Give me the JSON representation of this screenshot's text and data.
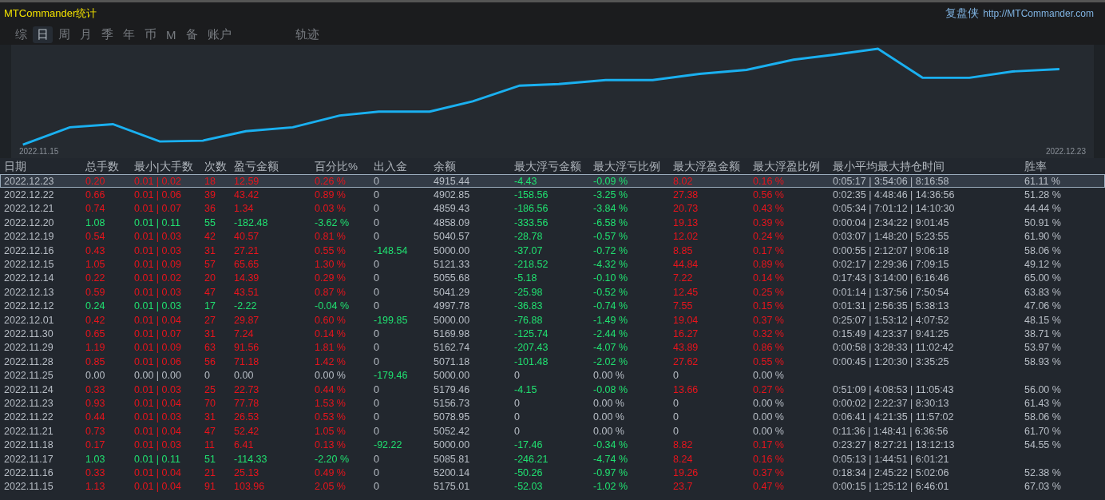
{
  "title": "MTCommander统计",
  "brand": {
    "name": "复盘侠",
    "url": "http://MTCommander.com"
  },
  "tabs": [
    {
      "label": "综",
      "selected": false
    },
    {
      "label": "日",
      "selected": true
    },
    {
      "label": "周",
      "selected": false
    },
    {
      "label": "月",
      "selected": false
    },
    {
      "label": "季",
      "selected": false
    },
    {
      "label": "年",
      "selected": false
    },
    {
      "label": "币",
      "selected": false
    },
    {
      "label": "M",
      "selected": false
    },
    {
      "label": "备",
      "selected": false
    },
    {
      "label": "账户",
      "selected": false
    },
    {
      "label": "轨迹",
      "selected": false
    }
  ],
  "chart": {
    "x_start": "2022.11.15",
    "x_end": "2022.12.23"
  },
  "table": {
    "columns": [
      "日期",
      "总手数",
      "最小|大手数",
      "次数",
      "盈亏金额",
      "百分比%",
      "出入金",
      "余额",
      "最大浮亏金额",
      "最大浮亏比例",
      "最大浮盈金额",
      "最大浮盈比例",
      "最小平均最大持仓时间",
      "胜率"
    ],
    "rows": [
      {
        "selected": true,
        "cells": [
          {
            "text": "2022.12.23",
            "color": "#b8bec6"
          },
          {
            "text": "0.20",
            "color": "#e8141c"
          },
          {
            "text": "0.01 | 0.02",
            "color": "#e8141c"
          },
          {
            "text": "18",
            "color": "#e8141c"
          },
          {
            "text": "12.59",
            "color": "#e8141c"
          },
          {
            "text": "0.26 %",
            "color": "#e8141c"
          },
          {
            "text": "0",
            "color": "#b8bec6"
          },
          {
            "text": "4915.44",
            "color": "#b8bec6"
          },
          {
            "text": "-4.43",
            "color": "#20e070"
          },
          {
            "text": "-0.09 %",
            "color": "#20e070"
          },
          {
            "text": "8.02",
            "color": "#e8141c"
          },
          {
            "text": "0.16 %",
            "color": "#e8141c"
          },
          {
            "text": "0:05:17 | 3:54:06 | 8:16:58",
            "color": "#b8bec6"
          },
          {
            "text": "61.11 %",
            "color": "#b8bec6"
          }
        ]
      },
      {
        "selected": false,
        "cells": [
          {
            "text": "2022.12.22",
            "color": "#b8bec6"
          },
          {
            "text": "0.66",
            "color": "#e8141c"
          },
          {
            "text": "0.01 | 0.06",
            "color": "#e8141c"
          },
          {
            "text": "39",
            "color": "#e8141c"
          },
          {
            "text": "43.42",
            "color": "#e8141c"
          },
          {
            "text": "0.89 %",
            "color": "#e8141c"
          },
          {
            "text": "0",
            "color": "#b8bec6"
          },
          {
            "text": "4902.85",
            "color": "#b8bec6"
          },
          {
            "text": "-158.56",
            "color": "#20e070"
          },
          {
            "text": "-3.25 %",
            "color": "#20e070"
          },
          {
            "text": "27.38",
            "color": "#e8141c"
          },
          {
            "text": "0.56 %",
            "color": "#e8141c"
          },
          {
            "text": "0:02:35 | 4:48:46 | 14:36:56",
            "color": "#b8bec6"
          },
          {
            "text": "51.28 %",
            "color": "#b8bec6"
          }
        ]
      },
      {
        "selected": false,
        "cells": [
          {
            "text": "2022.12.21",
            "color": "#b8bec6"
          },
          {
            "text": "0.74",
            "color": "#e8141c"
          },
          {
            "text": "0.01 | 0.07",
            "color": "#e8141c"
          },
          {
            "text": "36",
            "color": "#e8141c"
          },
          {
            "text": "1.34",
            "color": "#e8141c"
          },
          {
            "text": "0.03 %",
            "color": "#e8141c"
          },
          {
            "text": "0",
            "color": "#b8bec6"
          },
          {
            "text": "4859.43",
            "color": "#b8bec6"
          },
          {
            "text": "-186.56",
            "color": "#20e070"
          },
          {
            "text": "-3.84 %",
            "color": "#20e070"
          },
          {
            "text": "20.73",
            "color": "#e8141c"
          },
          {
            "text": "0.43 %",
            "color": "#e8141c"
          },
          {
            "text": "0:05:34 | 7:01:12 | 14:10:30",
            "color": "#b8bec6"
          },
          {
            "text": "44.44 %",
            "color": "#b8bec6"
          }
        ]
      },
      {
        "selected": false,
        "cells": [
          {
            "text": "2022.12.20",
            "color": "#b8bec6"
          },
          {
            "text": "1.08",
            "color": "#20e070"
          },
          {
            "text": "0.01 | 0.11",
            "color": "#20e070"
          },
          {
            "text": "55",
            "color": "#20e070"
          },
          {
            "text": "-182.48",
            "color": "#20e070"
          },
          {
            "text": "-3.62 %",
            "color": "#20e070"
          },
          {
            "text": "0",
            "color": "#b8bec6"
          },
          {
            "text": "4858.09",
            "color": "#b8bec6"
          },
          {
            "text": "-333.56",
            "color": "#20e070"
          },
          {
            "text": "-6.58 %",
            "color": "#20e070"
          },
          {
            "text": "19.13",
            "color": "#e8141c"
          },
          {
            "text": "0.39 %",
            "color": "#e8141c"
          },
          {
            "text": "0:00:04 | 2:34:22 | 9:01:45",
            "color": "#b8bec6"
          },
          {
            "text": "50.91 %",
            "color": "#b8bec6"
          }
        ]
      },
      {
        "selected": false,
        "cells": [
          {
            "text": "2022.12.19",
            "color": "#b8bec6"
          },
          {
            "text": "0.54",
            "color": "#e8141c"
          },
          {
            "text": "0.01 | 0.03",
            "color": "#e8141c"
          },
          {
            "text": "42",
            "color": "#e8141c"
          },
          {
            "text": "40.57",
            "color": "#e8141c"
          },
          {
            "text": "0.81 %",
            "color": "#e8141c"
          },
          {
            "text": "0",
            "color": "#b8bec6"
          },
          {
            "text": "5040.57",
            "color": "#b8bec6"
          },
          {
            "text": "-28.78",
            "color": "#20e070"
          },
          {
            "text": "-0.57 %",
            "color": "#20e070"
          },
          {
            "text": "12.02",
            "color": "#e8141c"
          },
          {
            "text": "0.24 %",
            "color": "#e8141c"
          },
          {
            "text": "0:03:07 | 1:48:20 | 5:23:55",
            "color": "#b8bec6"
          },
          {
            "text": "61.90 %",
            "color": "#b8bec6"
          }
        ]
      },
      {
        "selected": false,
        "cells": [
          {
            "text": "2022.12.16",
            "color": "#b8bec6"
          },
          {
            "text": "0.43",
            "color": "#e8141c"
          },
          {
            "text": "0.01 | 0.03",
            "color": "#e8141c"
          },
          {
            "text": "31",
            "color": "#e8141c"
          },
          {
            "text": "27.21",
            "color": "#e8141c"
          },
          {
            "text": "0.55 %",
            "color": "#e8141c"
          },
          {
            "text": "-148.54",
            "color": "#20e070"
          },
          {
            "text": "5000.00",
            "color": "#b8bec6"
          },
          {
            "text": "-37.07",
            "color": "#20e070"
          },
          {
            "text": "-0.72 %",
            "color": "#20e070"
          },
          {
            "text": "8.85",
            "color": "#e8141c"
          },
          {
            "text": "0.17 %",
            "color": "#e8141c"
          },
          {
            "text": "0:00:55 | 2:12:07 | 9:06:18",
            "color": "#b8bec6"
          },
          {
            "text": "58.06 %",
            "color": "#b8bec6"
          }
        ]
      },
      {
        "selected": false,
        "cells": [
          {
            "text": "2022.12.15",
            "color": "#b8bec6"
          },
          {
            "text": "1.05",
            "color": "#e8141c"
          },
          {
            "text": "0.01 | 0.09",
            "color": "#e8141c"
          },
          {
            "text": "57",
            "color": "#e8141c"
          },
          {
            "text": "65.65",
            "color": "#e8141c"
          },
          {
            "text": "1.30 %",
            "color": "#e8141c"
          },
          {
            "text": "0",
            "color": "#b8bec6"
          },
          {
            "text": "5121.33",
            "color": "#b8bec6"
          },
          {
            "text": "-218.52",
            "color": "#20e070"
          },
          {
            "text": "-4.32 %",
            "color": "#20e070"
          },
          {
            "text": "44.84",
            "color": "#e8141c"
          },
          {
            "text": "0.89 %",
            "color": "#e8141c"
          },
          {
            "text": "0:02:17 | 2:29:36 | 7:09:15",
            "color": "#b8bec6"
          },
          {
            "text": "49.12 %",
            "color": "#b8bec6"
          }
        ]
      },
      {
        "selected": false,
        "cells": [
          {
            "text": "2022.12.14",
            "color": "#b8bec6"
          },
          {
            "text": "0.22",
            "color": "#e8141c"
          },
          {
            "text": "0.01 | 0.02",
            "color": "#e8141c"
          },
          {
            "text": "20",
            "color": "#e8141c"
          },
          {
            "text": "14.39",
            "color": "#e8141c"
          },
          {
            "text": "0.29 %",
            "color": "#e8141c"
          },
          {
            "text": "0",
            "color": "#b8bec6"
          },
          {
            "text": "5055.68",
            "color": "#b8bec6"
          },
          {
            "text": "-5.18",
            "color": "#20e070"
          },
          {
            "text": "-0.10 %",
            "color": "#20e070"
          },
          {
            "text": "7.22",
            "color": "#e8141c"
          },
          {
            "text": "0.14 %",
            "color": "#e8141c"
          },
          {
            "text": "0:17:43 | 3:14:00 | 6:16:46",
            "color": "#b8bec6"
          },
          {
            "text": "65.00 %",
            "color": "#b8bec6"
          }
        ]
      },
      {
        "selected": false,
        "cells": [
          {
            "text": "2022.12.13",
            "color": "#b8bec6"
          },
          {
            "text": "0.59",
            "color": "#e8141c"
          },
          {
            "text": "0.01 | 0.03",
            "color": "#e8141c"
          },
          {
            "text": "47",
            "color": "#e8141c"
          },
          {
            "text": "43.51",
            "color": "#e8141c"
          },
          {
            "text": "0.87 %",
            "color": "#e8141c"
          },
          {
            "text": "0",
            "color": "#b8bec6"
          },
          {
            "text": "5041.29",
            "color": "#b8bec6"
          },
          {
            "text": "-25.98",
            "color": "#20e070"
          },
          {
            "text": "-0.52 %",
            "color": "#20e070"
          },
          {
            "text": "12.45",
            "color": "#e8141c"
          },
          {
            "text": "0.25 %",
            "color": "#e8141c"
          },
          {
            "text": "0:01:14 | 1:37:56 | 7:50:54",
            "color": "#b8bec6"
          },
          {
            "text": "63.83 %",
            "color": "#b8bec6"
          }
        ]
      },
      {
        "selected": false,
        "cells": [
          {
            "text": "2022.12.12",
            "color": "#b8bec6"
          },
          {
            "text": "0.24",
            "color": "#20e070"
          },
          {
            "text": "0.01 | 0.03",
            "color": "#20e070"
          },
          {
            "text": "17",
            "color": "#20e070"
          },
          {
            "text": "-2.22",
            "color": "#20e070"
          },
          {
            "text": "-0.04 %",
            "color": "#20e070"
          },
          {
            "text": "0",
            "color": "#b8bec6"
          },
          {
            "text": "4997.78",
            "color": "#b8bec6"
          },
          {
            "text": "-36.83",
            "color": "#20e070"
          },
          {
            "text": "-0.74 %",
            "color": "#20e070"
          },
          {
            "text": "7.55",
            "color": "#e8141c"
          },
          {
            "text": "0.15 %",
            "color": "#e8141c"
          },
          {
            "text": "0:01:31 | 2:56:35 | 5:38:13",
            "color": "#b8bec6"
          },
          {
            "text": "47.06 %",
            "color": "#b8bec6"
          }
        ]
      },
      {
        "selected": false,
        "cells": [
          {
            "text": "2022.12.01",
            "color": "#b8bec6"
          },
          {
            "text": "0.42",
            "color": "#e8141c"
          },
          {
            "text": "0.01 | 0.04",
            "color": "#e8141c"
          },
          {
            "text": "27",
            "color": "#e8141c"
          },
          {
            "text": "29.87",
            "color": "#e8141c"
          },
          {
            "text": "0.60 %",
            "color": "#e8141c"
          },
          {
            "text": "-199.85",
            "color": "#20e070"
          },
          {
            "text": "5000.00",
            "color": "#b8bec6"
          },
          {
            "text": "-76.88",
            "color": "#20e070"
          },
          {
            "text": "-1.49 %",
            "color": "#20e070"
          },
          {
            "text": "19.04",
            "color": "#e8141c"
          },
          {
            "text": "0.37 %",
            "color": "#e8141c"
          },
          {
            "text": "0:25:07 | 1:53:12 | 4:07:52",
            "color": "#b8bec6"
          },
          {
            "text": "48.15 %",
            "color": "#b8bec6"
          }
        ]
      },
      {
        "selected": false,
        "cells": [
          {
            "text": "2022.11.30",
            "color": "#b8bec6"
          },
          {
            "text": "0.65",
            "color": "#e8141c"
          },
          {
            "text": "0.01 | 0.07",
            "color": "#e8141c"
          },
          {
            "text": "31",
            "color": "#e8141c"
          },
          {
            "text": "7.24",
            "color": "#e8141c"
          },
          {
            "text": "0.14 %",
            "color": "#e8141c"
          },
          {
            "text": "0",
            "color": "#b8bec6"
          },
          {
            "text": "5169.98",
            "color": "#b8bec6"
          },
          {
            "text": "-125.74",
            "color": "#20e070"
          },
          {
            "text": "-2.44 %",
            "color": "#20e070"
          },
          {
            "text": "16.27",
            "color": "#e8141c"
          },
          {
            "text": "0.32 %",
            "color": "#e8141c"
          },
          {
            "text": "0:15:49 | 4:23:37 | 9:41:25",
            "color": "#b8bec6"
          },
          {
            "text": "38.71 %",
            "color": "#b8bec6"
          }
        ]
      },
      {
        "selected": false,
        "cells": [
          {
            "text": "2022.11.29",
            "color": "#b8bec6"
          },
          {
            "text": "1.19",
            "color": "#e8141c"
          },
          {
            "text": "0.01 | 0.09",
            "color": "#e8141c"
          },
          {
            "text": "63",
            "color": "#e8141c"
          },
          {
            "text": "91.56",
            "color": "#e8141c"
          },
          {
            "text": "1.81 %",
            "color": "#e8141c"
          },
          {
            "text": "0",
            "color": "#b8bec6"
          },
          {
            "text": "5162.74",
            "color": "#b8bec6"
          },
          {
            "text": "-207.43",
            "color": "#20e070"
          },
          {
            "text": "-4.07 %",
            "color": "#20e070"
          },
          {
            "text": "43.89",
            "color": "#e8141c"
          },
          {
            "text": "0.86 %",
            "color": "#e8141c"
          },
          {
            "text": "0:00:58 | 3:28:33 | 11:02:42",
            "color": "#b8bec6"
          },
          {
            "text": "53.97 %",
            "color": "#b8bec6"
          }
        ]
      },
      {
        "selected": false,
        "cells": [
          {
            "text": "2022.11.28",
            "color": "#b8bec6"
          },
          {
            "text": "0.85",
            "color": "#e8141c"
          },
          {
            "text": "0.01 | 0.06",
            "color": "#e8141c"
          },
          {
            "text": "56",
            "color": "#e8141c"
          },
          {
            "text": "71.18",
            "color": "#e8141c"
          },
          {
            "text": "1.42 %",
            "color": "#e8141c"
          },
          {
            "text": "0",
            "color": "#b8bec6"
          },
          {
            "text": "5071.18",
            "color": "#b8bec6"
          },
          {
            "text": "-101.48",
            "color": "#20e070"
          },
          {
            "text": "-2.02 %",
            "color": "#20e070"
          },
          {
            "text": "27.62",
            "color": "#e8141c"
          },
          {
            "text": "0.55 %",
            "color": "#e8141c"
          },
          {
            "text": "0:00:45 | 1:20:30 | 3:35:25",
            "color": "#b8bec6"
          },
          {
            "text": "58.93 %",
            "color": "#b8bec6"
          }
        ]
      },
      {
        "selected": false,
        "cells": [
          {
            "text": "2022.11.25",
            "color": "#b8bec6"
          },
          {
            "text": "0.00",
            "color": "#b8bec6"
          },
          {
            "text": "0.00 | 0.00",
            "color": "#b8bec6"
          },
          {
            "text": "0",
            "color": "#b8bec6"
          },
          {
            "text": "0.00",
            "color": "#b8bec6"
          },
          {
            "text": "0.00 %",
            "color": "#b8bec6"
          },
          {
            "text": "-179.46",
            "color": "#20e070"
          },
          {
            "text": "5000.00",
            "color": "#b8bec6"
          },
          {
            "text": "0",
            "color": "#b8bec6"
          },
          {
            "text": "0.00 %",
            "color": "#b8bec6"
          },
          {
            "text": "0",
            "color": "#b8bec6"
          },
          {
            "text": "0.00 %",
            "color": "#b8bec6"
          }
        ]
      },
      {
        "selected": false,
        "cells": [
          {
            "text": "2022.11.24",
            "color": "#b8bec6"
          },
          {
            "text": "0.33",
            "color": "#e8141c"
          },
          {
            "text": "0.01 | 0.03",
            "color": "#e8141c"
          },
          {
            "text": "25",
            "color": "#e8141c"
          },
          {
            "text": "22.73",
            "color": "#e8141c"
          },
          {
            "text": "0.44 %",
            "color": "#e8141c"
          },
          {
            "text": "0",
            "color": "#b8bec6"
          },
          {
            "text": "5179.46",
            "color": "#b8bec6"
          },
          {
            "text": "-4.15",
            "color": "#20e070"
          },
          {
            "text": "-0.08 %",
            "color": "#20e070"
          },
          {
            "text": "13.66",
            "color": "#e8141c"
          },
          {
            "text": "0.27 %",
            "color": "#e8141c"
          },
          {
            "text": "0:51:09 | 4:08:53 | 11:05:43",
            "color": "#b8bec6"
          },
          {
            "text": "56.00 %",
            "color": "#b8bec6"
          }
        ]
      },
      {
        "selected": false,
        "cells": [
          {
            "text": "2022.11.23",
            "color": "#b8bec6"
          },
          {
            "text": "0.93",
            "color": "#e8141c"
          },
          {
            "text": "0.01 | 0.04",
            "color": "#e8141c"
          },
          {
            "text": "70",
            "color": "#e8141c"
          },
          {
            "text": "77.78",
            "color": "#e8141c"
          },
          {
            "text": "1.53 %",
            "color": "#e8141c"
          },
          {
            "text": "0",
            "color": "#b8bec6"
          },
          {
            "text": "5156.73",
            "color": "#b8bec6"
          },
          {
            "text": "0",
            "color": "#b8bec6"
          },
          {
            "text": "0.00 %",
            "color": "#b8bec6"
          },
          {
            "text": "0",
            "color": "#b8bec6"
          },
          {
            "text": "0.00 %",
            "color": "#b8bec6"
          },
          {
            "text": "0:00:02 | 2:22:37 | 8:30:13",
            "color": "#b8bec6"
          },
          {
            "text": "61.43 %",
            "color": "#b8bec6"
          }
        ]
      },
      {
        "selected": false,
        "cells": [
          {
            "text": "2022.11.22",
            "color": "#b8bec6"
          },
          {
            "text": "0.44",
            "color": "#e8141c"
          },
          {
            "text": "0.01 | 0.03",
            "color": "#e8141c"
          },
          {
            "text": "31",
            "color": "#e8141c"
          },
          {
            "text": "26.53",
            "color": "#e8141c"
          },
          {
            "text": "0.53 %",
            "color": "#e8141c"
          },
          {
            "text": "0",
            "color": "#b8bec6"
          },
          {
            "text": "5078.95",
            "color": "#b8bec6"
          },
          {
            "text": "0",
            "color": "#b8bec6"
          },
          {
            "text": "0.00 %",
            "color": "#b8bec6"
          },
          {
            "text": "0",
            "color": "#b8bec6"
          },
          {
            "text": "0.00 %",
            "color": "#b8bec6"
          },
          {
            "text": "0:06:41 | 4:21:35 | 11:57:02",
            "color": "#b8bec6"
          },
          {
            "text": "58.06 %",
            "color": "#b8bec6"
          }
        ]
      },
      {
        "selected": false,
        "cells": [
          {
            "text": "2022.11.21",
            "color": "#b8bec6"
          },
          {
            "text": "0.73",
            "color": "#e8141c"
          },
          {
            "text": "0.01 | 0.04",
            "color": "#e8141c"
          },
          {
            "text": "47",
            "color": "#e8141c"
          },
          {
            "text": "52.42",
            "color": "#e8141c"
          },
          {
            "text": "1.05 %",
            "color": "#e8141c"
          },
          {
            "text": "0",
            "color": "#b8bec6"
          },
          {
            "text": "5052.42",
            "color": "#b8bec6"
          },
          {
            "text": "0",
            "color": "#b8bec6"
          },
          {
            "text": "0.00 %",
            "color": "#b8bec6"
          },
          {
            "text": "0",
            "color": "#b8bec6"
          },
          {
            "text": "0.00 %",
            "color": "#b8bec6"
          },
          {
            "text": "0:11:36 | 1:48:41 | 6:36:56",
            "color": "#b8bec6"
          },
          {
            "text": "61.70 %",
            "color": "#b8bec6"
          }
        ]
      },
      {
        "selected": false,
        "cells": [
          {
            "text": "2022.11.18",
            "color": "#b8bec6"
          },
          {
            "text": "0.17",
            "color": "#e8141c"
          },
          {
            "text": "0.01 | 0.03",
            "color": "#e8141c"
          },
          {
            "text": "11",
            "color": "#e8141c"
          },
          {
            "text": "6.41",
            "color": "#e8141c"
          },
          {
            "text": "0.13 %",
            "color": "#e8141c"
          },
          {
            "text": "-92.22",
            "color": "#20e070"
          },
          {
            "text": "5000.00",
            "color": "#b8bec6"
          },
          {
            "text": "-17.46",
            "color": "#20e070"
          },
          {
            "text": "-0.34 %",
            "color": "#20e070"
          },
          {
            "text": "8.82",
            "color": "#e8141c"
          },
          {
            "text": "0.17 %",
            "color": "#e8141c"
          },
          {
            "text": "0:23:27 | 8:27:21 | 13:12:13",
            "color": "#b8bec6"
          },
          {
            "text": "54.55 %",
            "color": "#b8bec6"
          }
        ]
      },
      {
        "selected": false,
        "cells": [
          {
            "text": "2022.11.17",
            "color": "#b8bec6"
          },
          {
            "text": "1.03",
            "color": "#20e070"
          },
          {
            "text": "0.01 | 0.11",
            "color": "#20e070"
          },
          {
            "text": "51",
            "color": "#20e070"
          },
          {
            "text": "-114.33",
            "color": "#20e070"
          },
          {
            "text": "-2.20 %",
            "color": "#20e070"
          },
          {
            "text": "0",
            "color": "#b8bec6"
          },
          {
            "text": "5085.81",
            "color": "#b8bec6"
          },
          {
            "text": "-246.21",
            "color": "#20e070"
          },
          {
            "text": "-4.74 %",
            "color": "#20e070"
          },
          {
            "text": "8.24",
            "color": "#e8141c"
          },
          {
            "text": "0.16 %",
            "color": "#e8141c"
          },
          {
            "text": "0:05:13 | 1:44:51 | 6:01:21",
            "color": "#b8bec6"
          }
        ]
      },
      {
        "selected": false,
        "cells": [
          {
            "text": "2022.11.16",
            "color": "#b8bec6"
          },
          {
            "text": "0.33",
            "color": "#e8141c"
          },
          {
            "text": "0.01 | 0.04",
            "color": "#e8141c"
          },
          {
            "text": "21",
            "color": "#e8141c"
          },
          {
            "text": "25.13",
            "color": "#e8141c"
          },
          {
            "text": "0.49 %",
            "color": "#e8141c"
          },
          {
            "text": "0",
            "color": "#b8bec6"
          },
          {
            "text": "5200.14",
            "color": "#b8bec6"
          },
          {
            "text": "-50.26",
            "color": "#20e070"
          },
          {
            "text": "-0.97 %",
            "color": "#20e070"
          },
          {
            "text": "19.26",
            "color": "#e8141c"
          },
          {
            "text": "0.37 %",
            "color": "#e8141c"
          },
          {
            "text": "0:18:34 | 2:45:22 | 5:02:06",
            "color": "#b8bec6"
          },
          {
            "text": "52.38 %",
            "color": "#b8bec6"
          }
        ]
      },
      {
        "selected": false,
        "cells": [
          {
            "text": "2022.11.15",
            "color": "#b8bec6"
          },
          {
            "text": "1.13",
            "color": "#e8141c"
          },
          {
            "text": "0.01 | 0.04",
            "color": "#e8141c"
          },
          {
            "text": "91",
            "color": "#e8141c"
          },
          {
            "text": "103.96",
            "color": "#e8141c"
          },
          {
            "text": "2.05 %",
            "color": "#e8141c"
          },
          {
            "text": "0",
            "color": "#b8bec6"
          },
          {
            "text": "5175.01",
            "color": "#b8bec6"
          },
          {
            "text": "-52.03",
            "color": "#20e070"
          },
          {
            "text": "-1.02 %",
            "color": "#20e070"
          },
          {
            "text": "23.7",
            "color": "#e8141c"
          },
          {
            "text": "0.47 %",
            "color": "#e8141c"
          },
          {
            "text": "0:00:15 | 1:25:12 | 6:46:01",
            "color": "#b8bec6"
          },
          {
            "text": "67.03 %",
            "color": "#b8bec6"
          }
        ]
      }
    ]
  }
}
